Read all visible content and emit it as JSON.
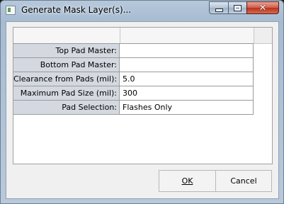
{
  "window": {
    "title": "Generate Mask Layer(s)...",
    "controls": {
      "minimize_icon": "minimize-icon",
      "maximize_icon": "maximize-icon",
      "close_glyph": "✕"
    }
  },
  "grid": {
    "rows": [
      {
        "label": "Top Pad Master:",
        "value": ""
      },
      {
        "label": "Bottom Pad Master:",
        "value": ""
      },
      {
        "label": "Clearance from Pads (mil):",
        "value": "5.0"
      },
      {
        "label": "Maximum Pad Size (mil):",
        "value": "300"
      },
      {
        "label": "Pad Selection:",
        "value": "Flashes Only"
      }
    ]
  },
  "buttons": {
    "ok_label": "OK",
    "cancel_label": "Cancel"
  }
}
